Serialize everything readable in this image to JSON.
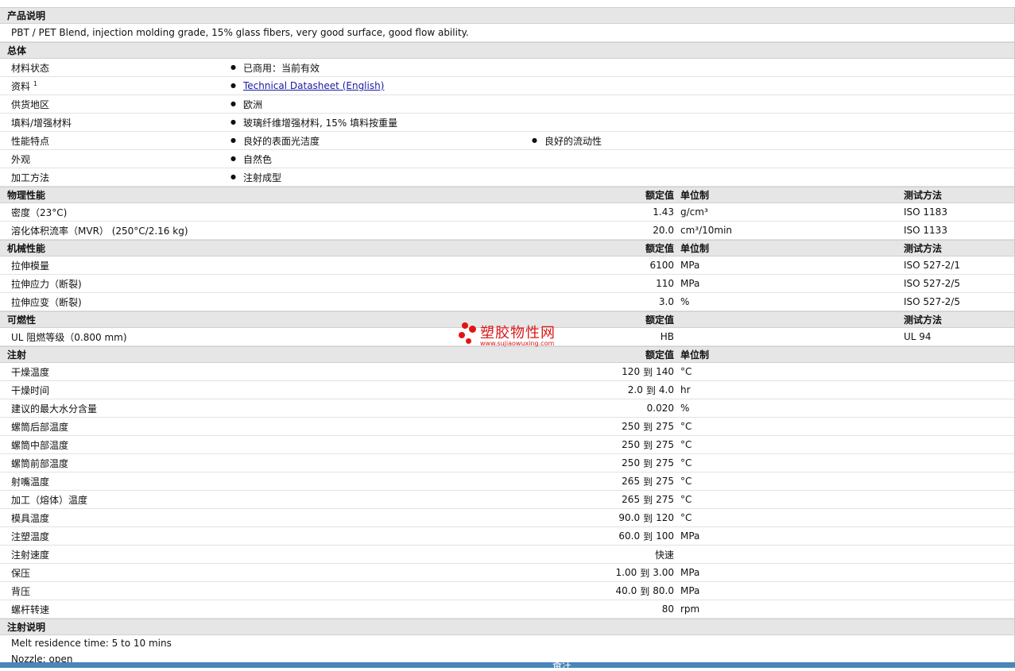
{
  "desc": {
    "header": "产品说明",
    "text": "PBT / PET Blend, injection molding grade, 15% glass fibers, very good surface, good flow ability."
  },
  "general": {
    "header": "总体",
    "rows": [
      {
        "label": "材料状态",
        "v1": "已商用：当前有效"
      },
      {
        "label": "资料",
        "sup": "1",
        "v1": "Technical Datasheet (English)"
      },
      {
        "label": "供货地区",
        "v1": "欧洲"
      },
      {
        "label": "填料/增强材料",
        "v1": "玻璃纤维增强材料, 15% 填料按重量"
      },
      {
        "label": "性能特点",
        "v1": "良好的表面光洁度",
        "v2": "良好的流动性"
      },
      {
        "label": "外观",
        "v1": "自然色"
      },
      {
        "label": "加工方法",
        "v1": "注射成型"
      }
    ]
  },
  "columns": {
    "value": "额定值",
    "unit": "单位制",
    "test": "测试方法"
  },
  "physical": {
    "header": "物理性能",
    "rows": [
      {
        "label": "密度（23°C)",
        "value": "1.43",
        "unit": "g/cm³",
        "test": "ISO 1183"
      },
      {
        "label": "溶化体积流率（MVR） (250°C/2.16 kg)",
        "value": "20.0",
        "unit": "cm³/10min",
        "test": "ISO 1133"
      }
    ]
  },
  "mechanical": {
    "header": "机械性能",
    "rows": [
      {
        "label": "拉伸模量",
        "value": "6100",
        "unit": "MPa",
        "test": "ISO 527-2/1"
      },
      {
        "label": "拉伸应力（断裂)",
        "value": "110",
        "unit": "MPa",
        "test": "ISO 527-2/5"
      },
      {
        "label": "拉伸应变（断裂)",
        "value": "3.0",
        "unit": "%",
        "test": "ISO 527-2/5"
      }
    ]
  },
  "flammability": {
    "header": "可燃性",
    "rows": [
      {
        "label": "UL 阻燃等级（0.800 mm)",
        "value": "HB",
        "unit": "",
        "test": "UL 94"
      }
    ]
  },
  "injection": {
    "header": "注射",
    "to": "到",
    "rows": [
      {
        "label": "干燥温度",
        "from": "120",
        "upto": "140",
        "unit": "°C"
      },
      {
        "label": "干燥时间",
        "from": "2.0",
        "upto": "4.0",
        "unit": "hr"
      },
      {
        "label": "建议的最大水分含量",
        "value": "0.020",
        "unit": "%"
      },
      {
        "label": "螺筒后部温度",
        "from": "250",
        "upto": "275",
        "unit": "°C"
      },
      {
        "label": "螺筒中部温度",
        "from": "250",
        "upto": "275",
        "unit": "°C"
      },
      {
        "label": "螺筒前部温度",
        "from": "250",
        "upto": "275",
        "unit": "°C"
      },
      {
        "label": "射嘴温度",
        "from": "265",
        "upto": "275",
        "unit": "°C"
      },
      {
        "label": "加工（熔体）温度",
        "from": "265",
        "upto": "275",
        "unit": "°C"
      },
      {
        "label": "模具温度",
        "from": "90.0",
        "upto": "120",
        "unit": "°C"
      },
      {
        "label": "注塑温度",
        "from": "60.0",
        "upto": "100",
        "unit": "MPa"
      },
      {
        "label": "注射速度",
        "value": "快速",
        "unit": ""
      },
      {
        "label": "保压",
        "from": "1.00",
        "upto": "3.00",
        "unit": "MPa"
      },
      {
        "label": "背压",
        "from": "40.0",
        "upto": "80.0",
        "unit": "MPa"
      },
      {
        "label": "螺杆转速",
        "value": "80",
        "unit": "rpm"
      }
    ]
  },
  "notes": {
    "header": "注射说明",
    "lines": [
      "Melt residence time: 5 to 10 mins",
      "Nozzle: open"
    ]
  },
  "footer": {
    "label": "备注"
  },
  "watermark": {
    "title": "塑胶物性网",
    "url": "www.sujiaowuxing.com",
    "color": "#d81818"
  }
}
